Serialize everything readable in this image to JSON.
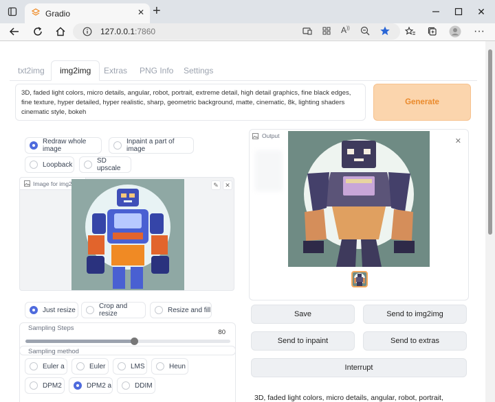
{
  "browser": {
    "tab_title": "Gradio",
    "url_host": "127.0.0.1",
    "url_port": ":7860"
  },
  "app": {
    "tabs": [
      "txt2img",
      "img2img",
      "Extras",
      "PNG Info",
      "Settings"
    ],
    "active_tab": "img2img",
    "prompt": "3D, faded light colors, micro details, angular, robot, portrait, extreme detail, high detail graphics, fine black edges, fine texture, hyper detailed, hyper realistic, sharp, geometric background, matte, cinematic, 8k, lighting shaders cinematic style, bokeh",
    "generate_label": "Generate",
    "mode_options": [
      "Redraw whole image",
      "Inpaint a part of image",
      "Loopback",
      "SD upscale"
    ],
    "mode_selected": "Redraw whole image",
    "image_label": "Image for img2img",
    "resize_options": [
      "Just resize",
      "Crop and resize",
      "Resize and fill"
    ],
    "resize_selected": "Just resize",
    "sampling_steps_label": "Sampling Steps",
    "sampling_steps_value": "80",
    "sampling_steps_fraction": 0.53,
    "sampling_method_label": "Sampling method",
    "sampling_methods": [
      "Euler a",
      "Euler",
      "LMS",
      "Heun",
      "DPM2",
      "DPM2 a",
      "DDIM"
    ],
    "sampling_method_selected": "DPM2 a",
    "output_label": "Output",
    "buttons": {
      "save": "Save",
      "send_img2img": "Send to img2img",
      "send_inpaint": "Send to inpaint",
      "send_extras": "Send to extras",
      "interrupt": "Interrupt"
    },
    "output_text": "3D, faded light colors, micro details, angular, robot, portrait,"
  },
  "colors": {
    "accent": "#4f6bdd",
    "generate_bg": "#fbd5ad",
    "generate_text": "#ea8a2c"
  }
}
